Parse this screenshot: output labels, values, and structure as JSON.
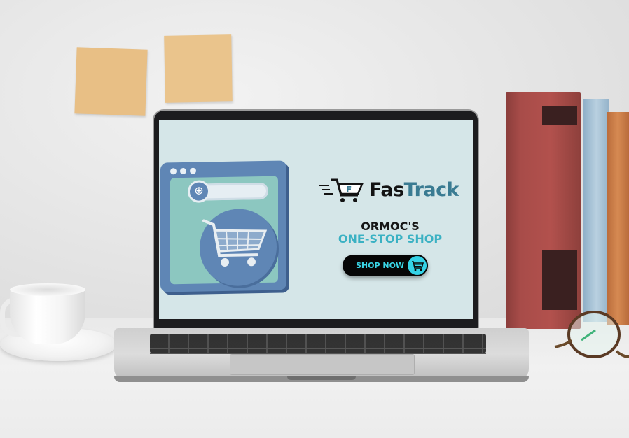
{
  "brand": {
    "name_part1": "Fas",
    "name_part2": "Track",
    "accent_color": "#3a7b92",
    "icon": "shopping-cart-logo-icon"
  },
  "headline": {
    "line1": "ORMOC'S",
    "line2": "ONE-STOP SHOP",
    "line2_color": "#3ab1c3"
  },
  "cta": {
    "label": "SHOP NOW",
    "icon": "cart-icon",
    "button_color": "#060606",
    "label_color": "#3ad5e6"
  },
  "illustration": {
    "browser_icon": "browser-window-icon",
    "search_icon": "globe-icon",
    "cart_icon": "shopping-cart-icon"
  }
}
